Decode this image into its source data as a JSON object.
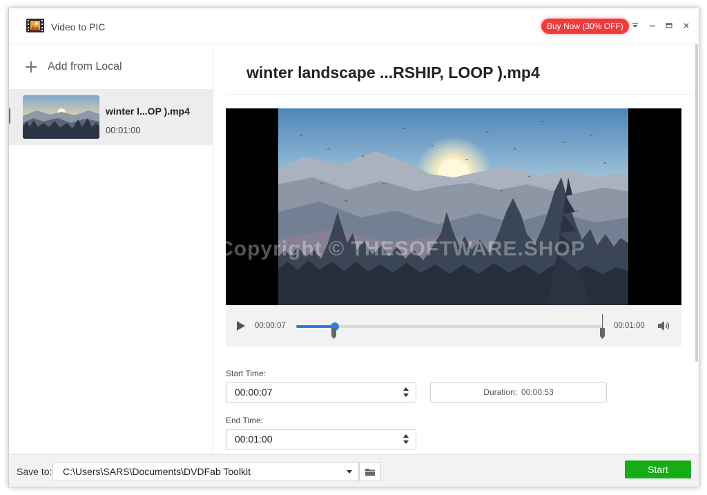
{
  "app": {
    "title": "Video to PIC",
    "buy_label": "Buy Now (30% OFF)"
  },
  "sidebar": {
    "add_label": "Add from Local",
    "files": [
      {
        "name": "winter l...OP ).mp4",
        "duration": "00:01:00"
      }
    ]
  },
  "main": {
    "video_title": "winter landscape ...RSHIP, LOOP ).mp4",
    "watermark": "Copyright © THESOFTWARE.SHOP",
    "player": {
      "current_time": "00:00:07",
      "end_time": "00:01:00"
    },
    "start_time": {
      "label": "Start Time:",
      "value": "00:00:07"
    },
    "end_time": {
      "label": "End Time:",
      "value": "00:01:00"
    },
    "duration": {
      "label": "Duration:",
      "value": "00:00:53"
    }
  },
  "bottom": {
    "save_label": "Save to:",
    "save_path": "C:\\Users\\SARS\\Documents\\DVDFab Toolkit",
    "start_label": "Start"
  },
  "colors": {
    "accent": "#2f7de1",
    "buy": "#ef3b3b",
    "start": "#16ac16"
  }
}
